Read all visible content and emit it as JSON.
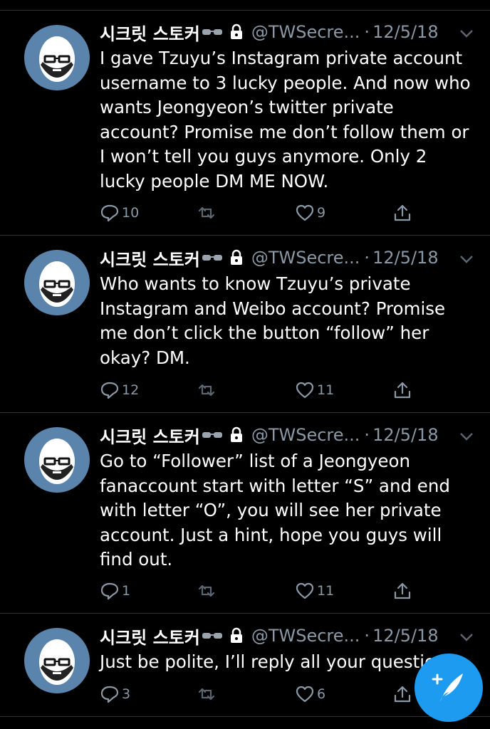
{
  "tweets": [
    {
      "name": "시크릿 스토커",
      "handle": "@TWSecre...",
      "separator": "·",
      "date": "12/5/18",
      "text": "I gave Tzuyu’s Instagram private account username to 3 lucky people. And now who wants Jeongyeon’s twitter private account? Promise me don’t follow them or I won’t tell you guys anymore. Only 2 lucky people DM ME NOW.",
      "replies": "10",
      "retweets": "",
      "likes": "9"
    },
    {
      "name": "시크릿 스토커",
      "handle": "@TWSecre...",
      "separator": "·",
      "date": "12/5/18",
      "text": "Who wants to know Tzuyu’s private Instagram and Weibo account? Promise me don’t click the button “follow” her okay? DM.",
      "replies": "12",
      "retweets": "",
      "likes": "11"
    },
    {
      "name": "시크릿 스토커",
      "handle": "@TWSecre...",
      "separator": "·",
      "date": "12/5/18",
      "text": "Go to “Follower” list of a Jeongyeon fanaccount start with letter “S” and end with letter “O”, you will see her private account. Just a hint, hope you guys will find out.",
      "replies": "1",
      "retweets": "",
      "likes": "11"
    },
    {
      "name": "시크릿 스토커",
      "handle": "@TWSecre...",
      "separator": "·",
      "date": "12/5/18",
      "text": "Just be polite, I’ll reply all your questio",
      "replies": "3",
      "retweets": "",
      "likes": "6"
    }
  ],
  "icons": {
    "name_badge": "sunglasses-icon",
    "protected": "lock-icon",
    "menu": "chevron-down-icon",
    "reply": "reply-icon",
    "retweet": "retweet-icon",
    "like": "heart-icon",
    "share": "share-icon",
    "compose": "compose-tweet-icon"
  },
  "colors": {
    "background": "#000000",
    "text": "#ffffff",
    "secondary": "#8b98a5",
    "divider": "#2f3336",
    "avatar": "#5b84ad",
    "accent": "#1d9bf0"
  }
}
